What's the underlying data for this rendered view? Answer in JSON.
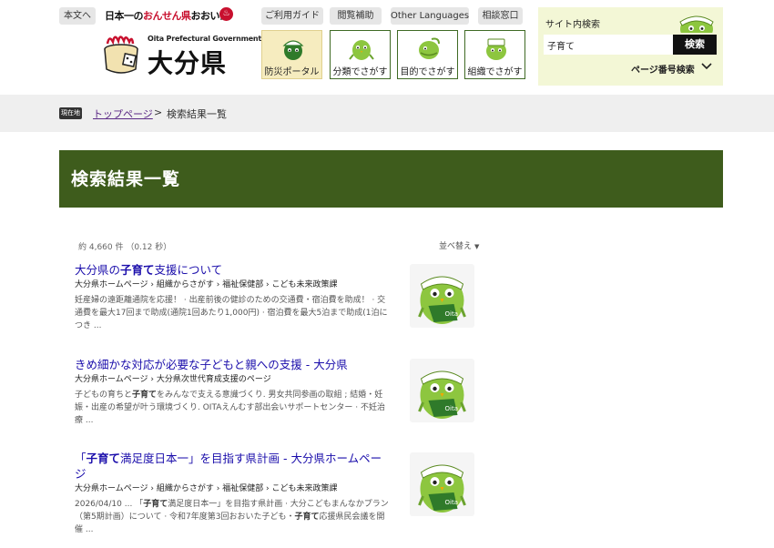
{
  "header": {
    "skip_label": "本文へ",
    "onsen_black1": "日本一の",
    "onsen_red": "おんせん県",
    "onsen_black2": "おおいた",
    "onsen_mark": "♨",
    "logo_sub": "Oita Prefectural Government",
    "logo_main": "大分県",
    "util": [
      "ご利用ガイド",
      "閲覧補助",
      "Other Languages",
      "相談窓口"
    ],
    "nav": [
      {
        "label": "防災ポータル",
        "icon": "mascot-helmet-icon",
        "active": true
      },
      {
        "label": "分類でさがす",
        "icon": "mascot-search-icon",
        "active": false
      },
      {
        "label": "目的でさがす",
        "icon": "mascot-purpose-icon",
        "active": false
      },
      {
        "label": "組織でさがす",
        "icon": "mascot-organization-icon",
        "active": false
      }
    ],
    "search": {
      "title": "サイト内検索",
      "value": "子育て",
      "button": "検索",
      "page_number": "ページ番号検索"
    }
  },
  "breadcrumb": {
    "badge": "現在地",
    "home": "トップページ",
    "sep": ">",
    "current": "検索結果一覧"
  },
  "page_title": "検索結果一覧",
  "results_meta": {
    "count": "約 4,660 件 （0.12 秒）",
    "sort": "並べ替え"
  },
  "results": [
    {
      "title_pre": "大分県の",
      "title_bold": "子育て",
      "title_post": "支援について",
      "crumb": "大分県ホームページ › 組織からさがす › 福祉保健部 › こども未来政策課",
      "snip_l1": "妊産婦の遠距離通院を応援！ · 出産前後の健診のための交通費・宿泊費を助成！ · 交",
      "snip_l2": "通費を最大17回まで助成(通院1回あたり1,000円) · 宿泊費を最大5泊まで助成(1泊に",
      "snip_l3": "つき ..."
    },
    {
      "title_pre": "きめ細かな対応が必要な子どもと親への支援 - 大分県",
      "title_bold": "",
      "title_post": "",
      "crumb": "大分県ホームページ › 大分県次世代育成支援のページ",
      "snip_l1_pre": "子どもの育ちと",
      "snip_l1_bold": "子育て",
      "snip_l1_post": "をみんなで支える意識づくり. 男女共同参画の取組 ; 結婚・妊",
      "snip_l2": "娠・出産の希望が叶う環境づくり. OITAえんむす部出会いサポートセンター · 不妊治",
      "snip_l3": "療 ..."
    },
    {
      "title_pre": "「",
      "title_bold": "子育て",
      "title_post": "満足度日本一」を目指す県計画 - 大分県ホームペー",
      "title_line2": "ジ",
      "crumb": "大分県ホームページ › 組織からさがす › 福祉保健部 › こども未来政策課",
      "snip_l1_pre": "2026/04/10 ... 「",
      "snip_l1_bold": "子育て",
      "snip_l1_post": "満足度日本一」を目指す県計画 · 大分こどもまんなかプラン",
      "snip_l2_pre": "（第5期計画）について · 令和7年度第3回おおいた子ども・",
      "snip_l2_bold": "子育て",
      "snip_l2_post": "応援県民会議を開",
      "snip_l3": "催 ..."
    }
  ],
  "result_thumb_icon": "mascot-mejiron-icon",
  "colors": {
    "title_bar": "#3e5c1c",
    "search_bg": "#f3f7d6",
    "link": "#1a0dab",
    "crumb_link": "#5b2a86"
  }
}
